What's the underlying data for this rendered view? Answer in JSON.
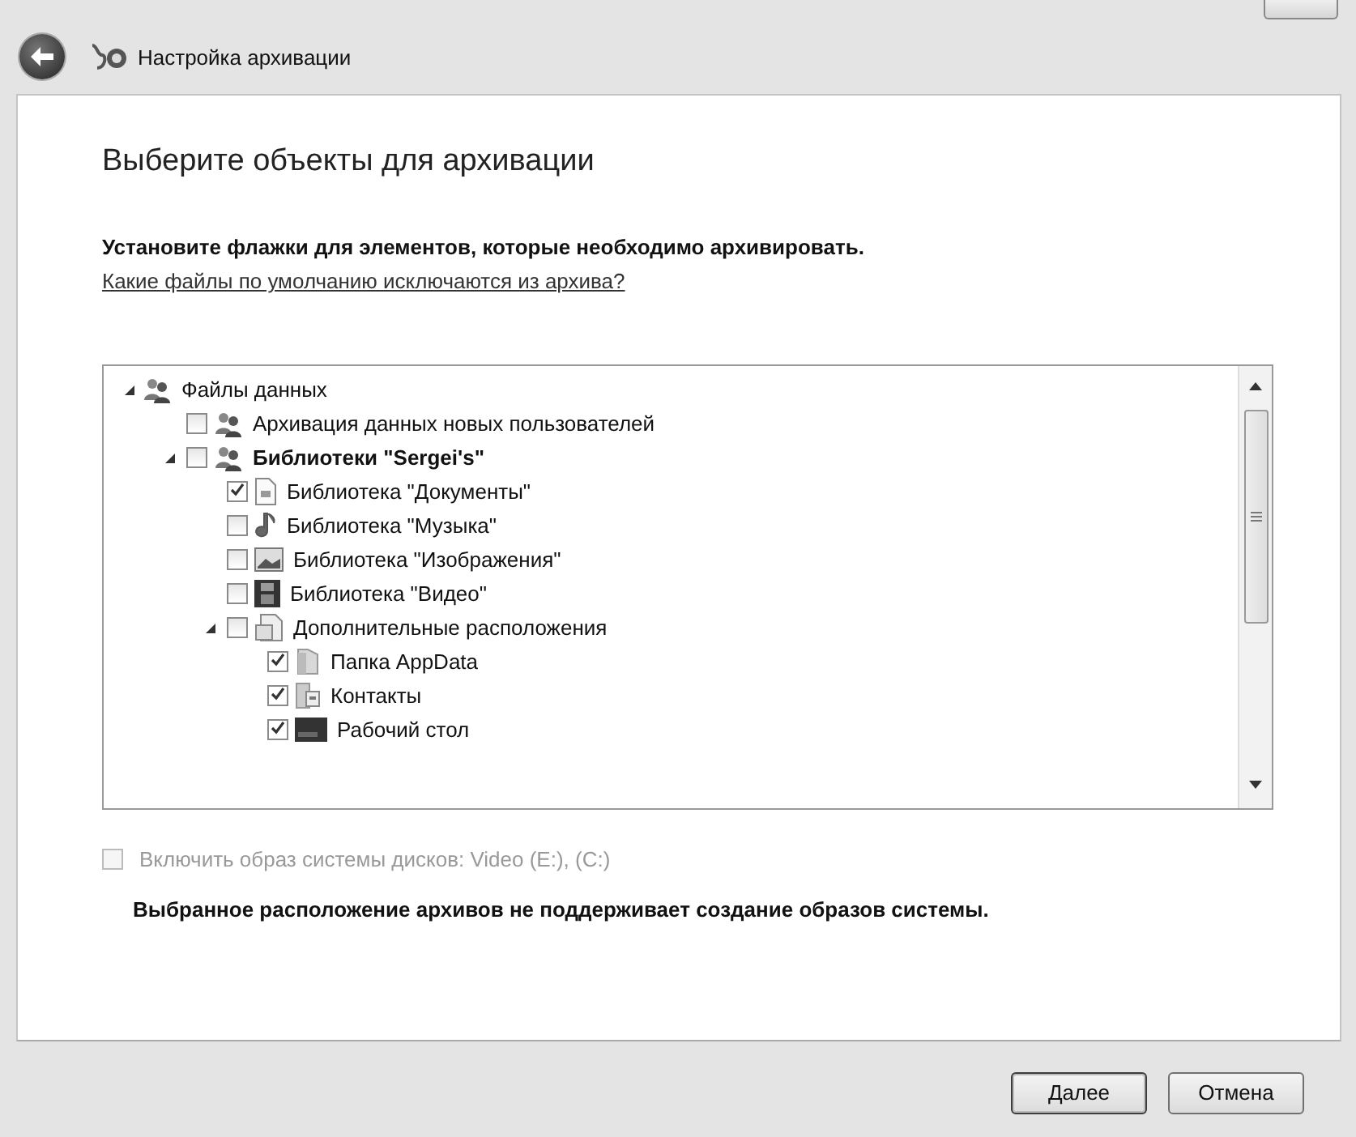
{
  "window": {
    "title": "Настройка архивации"
  },
  "heading": "Выберите объекты для архивации",
  "instruction": {
    "text": "Установите флажки для элементов, которые необходимо архивировать.",
    "link": "Какие файлы по умолчанию исключаются из архива?"
  },
  "tree": {
    "items": [
      {
        "label": "Файлы данных",
        "expanded": true,
        "bold": false,
        "children": [
          {
            "label": "Архивация данных новых пользователей",
            "checked": false,
            "bold": false
          },
          {
            "label": "Библиотеки \"Sergei's\"",
            "checked": false,
            "expanded": true,
            "bold": true,
            "children": [
              {
                "label": "Библиотека \"Документы\"",
                "checked": true,
                "bold": false
              },
              {
                "label": "Библиотека \"Музыка\"",
                "checked": false,
                "bold": false
              },
              {
                "label": "Библиотека \"Изображения\"",
                "checked": false,
                "bold": false
              },
              {
                "label": "Библиотека \"Видео\"",
                "checked": false,
                "bold": false
              },
              {
                "label": "Дополнительные расположения",
                "checked": false,
                "expanded": true,
                "bold": false,
                "children": [
                  {
                    "label": "Папка AppData",
                    "checked": true,
                    "bold": false
                  },
                  {
                    "label": "Контакты",
                    "checked": true,
                    "bold": false
                  },
                  {
                    "label": "Рабочий стол",
                    "checked": true,
                    "bold": false
                  }
                ]
              }
            ]
          }
        ]
      }
    ]
  },
  "system_image": {
    "label": "Включить образ системы дисков: Video (E:), (C:)",
    "checked": false,
    "disabled": true
  },
  "note": "Выбранное расположение архивов не поддерживает создание образов системы.",
  "buttons": [
    {
      "label": "Далее",
      "default": true
    },
    {
      "label": "Отмена",
      "default": false
    }
  ]
}
